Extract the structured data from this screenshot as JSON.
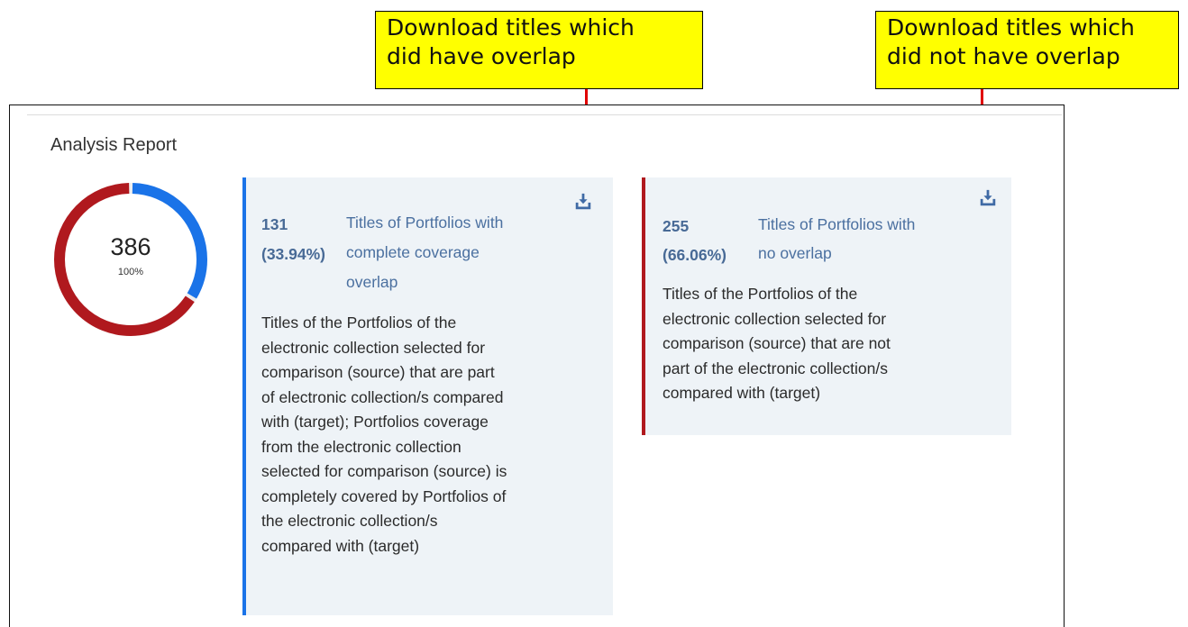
{
  "callouts": {
    "overlap": {
      "line1": "Download titles which",
      "line2": "did have overlap"
    },
    "no_overlap": {
      "line1": "Download titles which",
      "line2": "did not have overlap"
    },
    "arrow_color": "#e00000",
    "background": "#ffff00"
  },
  "report": {
    "title": "Analysis Report",
    "donut": {
      "total": "386",
      "percent": "100%",
      "segments": [
        {
          "name": "complete coverage overlap",
          "value": 131,
          "color": "#1a73e8"
        },
        {
          "name": "no overlap",
          "value": 255,
          "color": "#b0191e"
        }
      ]
    },
    "cards": [
      {
        "count": "131",
        "percent": "(33.94%)",
        "label_lines": [
          "Titles of Portfolios with",
          "complete coverage",
          "overlap"
        ],
        "description_lines": [
          "Titles of the Portfolios of the",
          "electronic collection selected for",
          "comparison (source) that are part",
          "of electronic collection/s compared",
          "with (target); Portfolios coverage",
          "from the electronic collection",
          "selected for comparison (source) is",
          "completely covered by Portfolios of",
          "the electronic collection/s",
          "compared with (target)"
        ],
        "accent": "#1a73e8",
        "download_icon": "download-icon"
      },
      {
        "count": "255",
        "percent": "(66.06%)",
        "label_lines": [
          "Titles of Portfolios with",
          "no overlap"
        ],
        "description_lines": [
          "Titles of the Portfolios of the",
          "electronic collection selected for",
          "comparison (source) that are not",
          "part of the electronic collection/s",
          "compared with (target)"
        ],
        "accent": "#b0191e",
        "download_icon": "download-icon"
      }
    ]
  }
}
